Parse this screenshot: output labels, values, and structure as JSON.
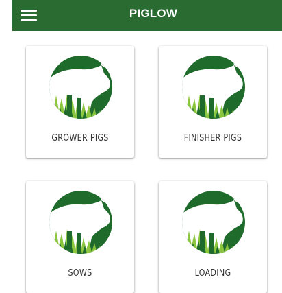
{
  "app": {
    "title": "PIGLOW"
  },
  "tiles": [
    {
      "label": "GROWER PIGS"
    },
    {
      "label": "FINISHER PIGS"
    },
    {
      "label": "SOWS"
    },
    {
      "label": "LOADING"
    }
  ],
  "colors": {
    "appbar": "#2a6b32",
    "logo_green": "#1f6b2c",
    "grass_light": "#8cc63f"
  },
  "icons": {
    "menu": "hamburger-menu-icon",
    "tile_logo": "pig-logo-icon"
  }
}
